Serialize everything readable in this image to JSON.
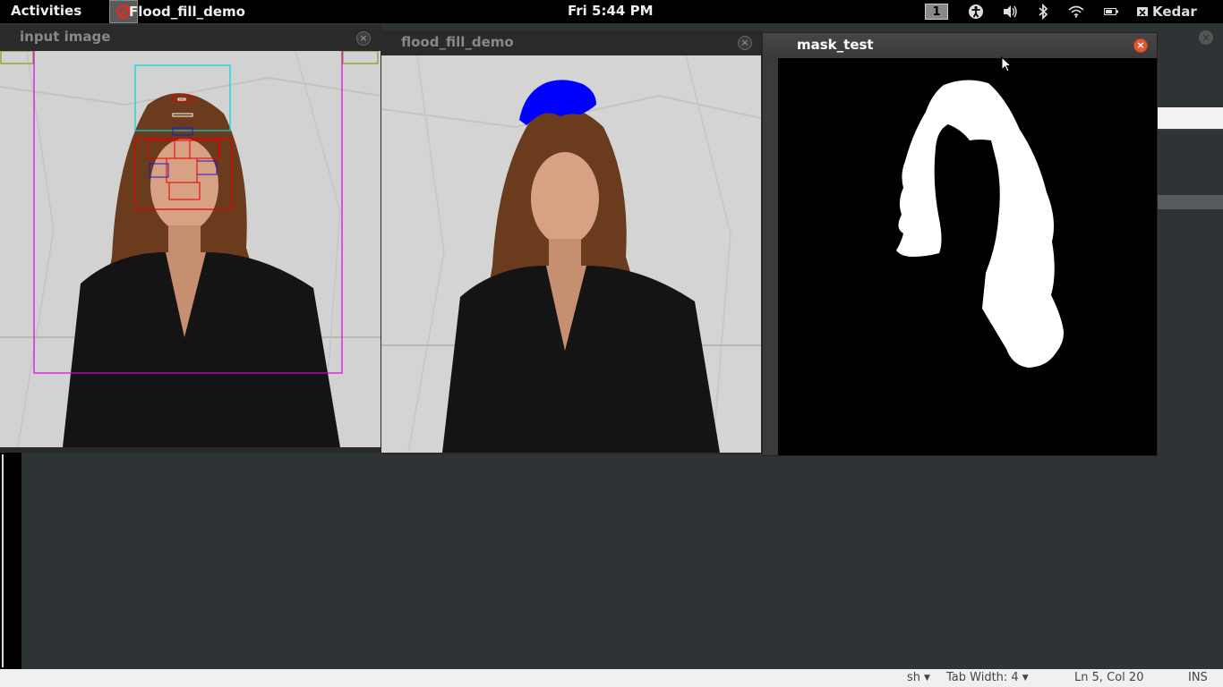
{
  "topbar": {
    "activities": "Activities",
    "app_title": "Flood_fill_demo",
    "clock": "Fri   5:44 PM",
    "workspace": "1",
    "user": "Kedar",
    "icons": [
      "accessibility-icon",
      "volume-icon",
      "bluetooth-icon",
      "wifi-icon",
      "battery-icon",
      "user-icon"
    ]
  },
  "windows": {
    "input": {
      "title": "input image"
    },
    "flood": {
      "title": "flood_fill_demo"
    },
    "mask": {
      "title": "mask_test"
    }
  },
  "statusbar": {
    "language": "sh",
    "tab_width": "Tab Width:  4",
    "position": "Ln 5, Col 20",
    "mode": "INS"
  },
  "colors": {
    "detect_face": "#e100e1",
    "detect_hair": "#00d5d5",
    "detect_red": "#e00000",
    "detect_blue": "#1a1ad6",
    "flood_fill": "#0000ff",
    "mask_fg": "#ffffff",
    "mask_bg": "#000000",
    "close_active": "#e15a32"
  }
}
